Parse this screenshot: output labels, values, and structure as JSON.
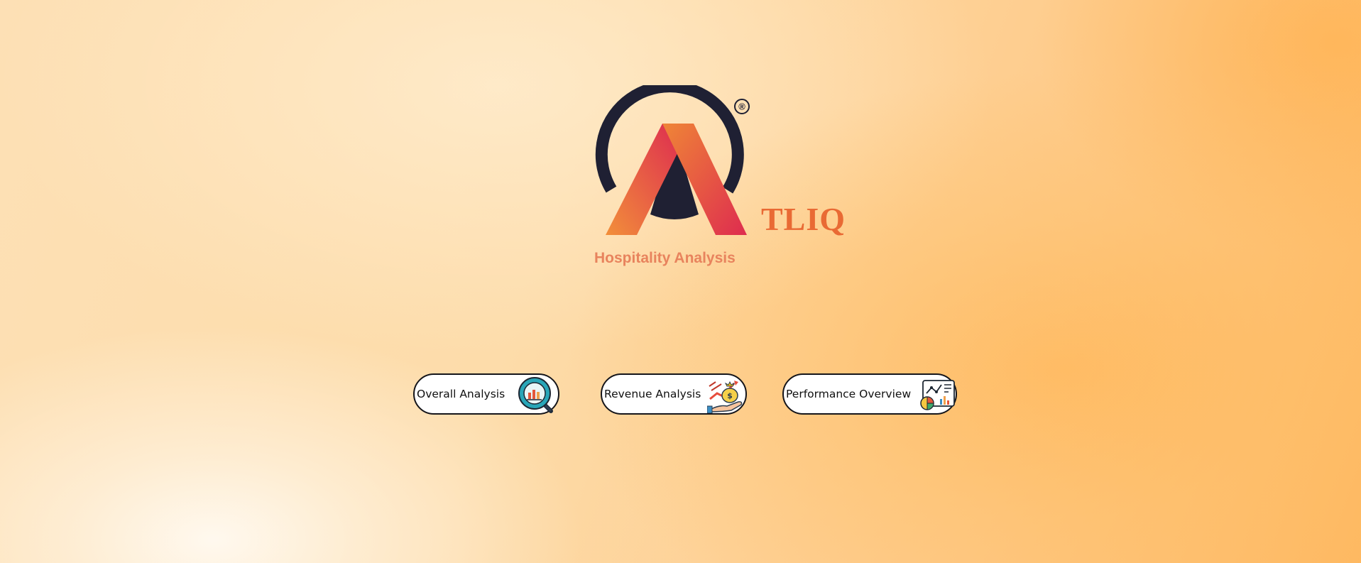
{
  "brand": {
    "name": "TLIQ",
    "subtitle": "Hospitality Analysis",
    "registered_mark": "®",
    "colors": {
      "accent_orange": "#e96a34",
      "subtitle_orange": "#e8835d",
      "arc_dark": "#1f2033",
      "gradient_start": "#f08a3a",
      "gradient_end": "#df2a4e"
    }
  },
  "nav": {
    "buttons": [
      {
        "label": "Overall Analysis",
        "icon": "magnifier-bar-chart-icon"
      },
      {
        "label": "Revenue Analysis",
        "icon": "hand-money-bag-growth-icon"
      },
      {
        "label": "Performance Overview",
        "icon": "dashboard-report-icon"
      }
    ]
  }
}
